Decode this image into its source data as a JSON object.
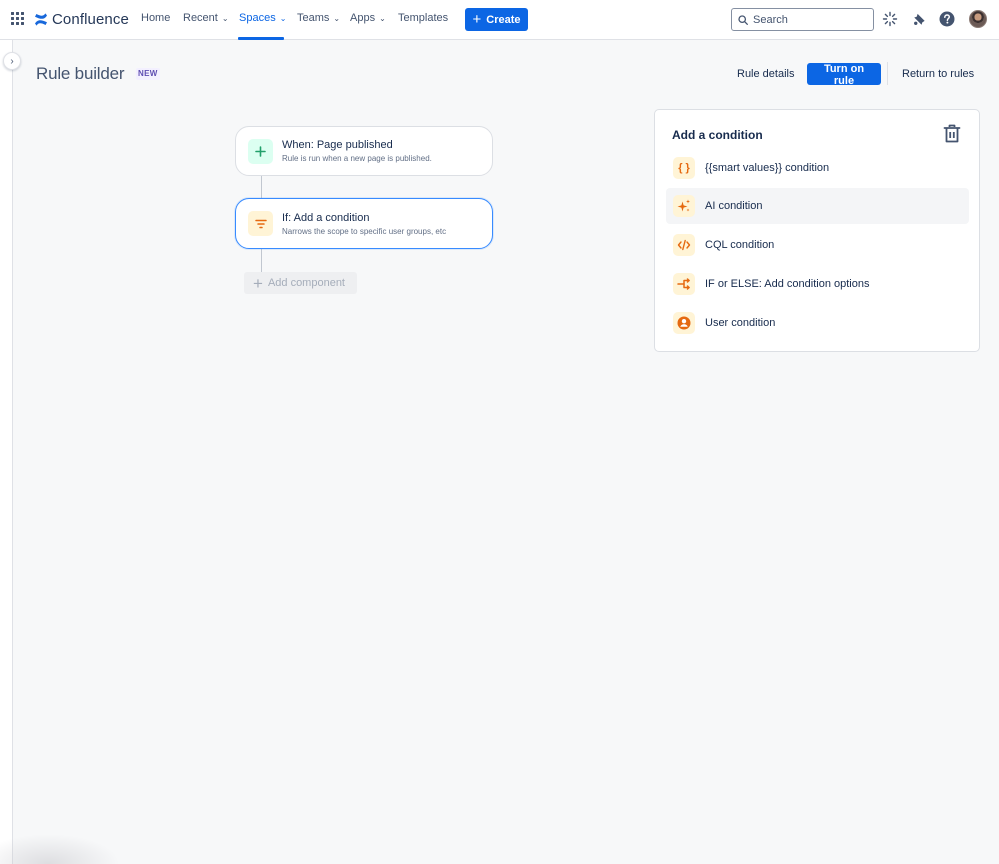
{
  "topnav": {
    "product": "Confluence",
    "items": [
      {
        "label": "Home",
        "has_menu": false,
        "active": false
      },
      {
        "label": "Recent",
        "has_menu": true,
        "active": false
      },
      {
        "label": "Spaces",
        "has_menu": true,
        "active": true
      },
      {
        "label": "Teams",
        "has_menu": true,
        "active": false
      },
      {
        "label": "Apps",
        "has_menu": true,
        "active": false
      },
      {
        "label": "Templates",
        "has_menu": false,
        "active": false
      }
    ],
    "create_label": "Create",
    "search_placeholder": "Search",
    "icons": [
      "app-switcher-icon",
      "ai-sparkle-icon",
      "notifications-bell-icon",
      "help-icon",
      "profile-avatar"
    ]
  },
  "header": {
    "title": "Rule builder",
    "badge": "NEW",
    "buttons": {
      "rule_details": "Rule details",
      "turn_on": "Turn on rule",
      "return": "Return to rules"
    }
  },
  "flow": {
    "trigger": {
      "title": "When: Page published",
      "subtitle": "Rule is run when a new page is published.",
      "icon": "plus-icon"
    },
    "condition": {
      "title": "If: Add a condition",
      "subtitle": "Narrows the scope to specific user groups, etc",
      "icon": "filter-icon"
    },
    "add_component_label": "Add component"
  },
  "panel": {
    "title": "Add a condition",
    "items": [
      {
        "label": "{{smart values}} condition",
        "icon": "curly-braces-icon"
      },
      {
        "label": "AI condition",
        "icon": "ai-sparkle-icon",
        "hovered": true
      },
      {
        "label": "CQL condition",
        "icon": "code-icon"
      },
      {
        "label": "IF or ELSE: Add condition options",
        "icon": "branch-icon"
      },
      {
        "label": "User condition",
        "icon": "user-icon"
      }
    ]
  },
  "colors": {
    "accent": "#0c66e4",
    "selected_border": "#388bff",
    "condition_icon": "#e56910",
    "condition_icon_bg": "#fff4d6",
    "trigger_icon": "#22a06b",
    "trigger_icon_bg": "#dcfff1"
  }
}
